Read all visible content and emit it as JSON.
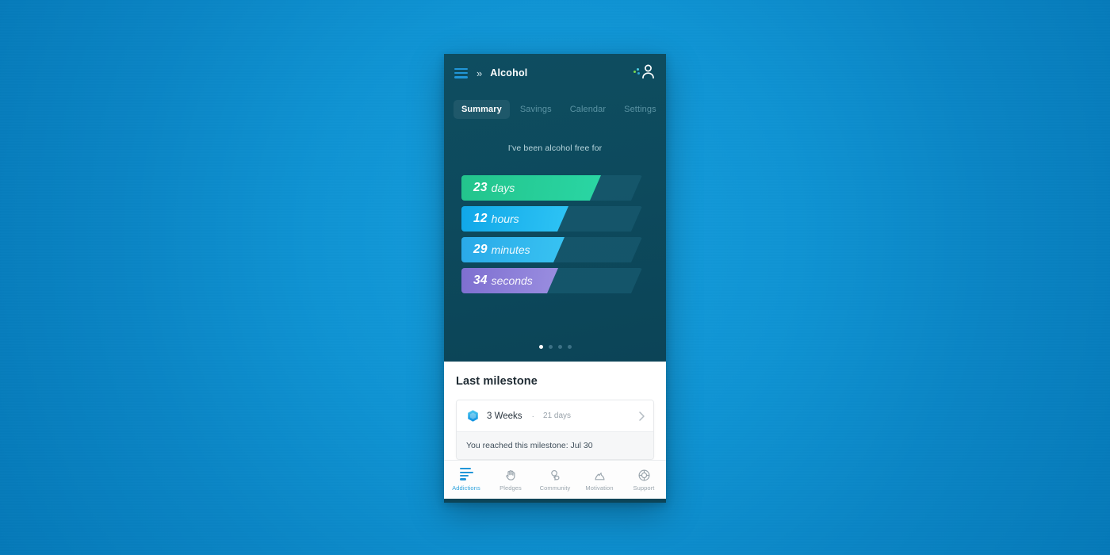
{
  "app": {
    "title": "Alcohol",
    "menu_icon": "hamburger-icon",
    "breadcrumb_chevrons": "»",
    "avatar_icon": "user-avatar-icon"
  },
  "tabs": [
    {
      "label": "Summary",
      "active": true
    },
    {
      "label": "Savings",
      "active": false
    },
    {
      "label": "Calendar",
      "active": false
    },
    {
      "label": "Settings",
      "active": false
    }
  ],
  "summary": {
    "caption": "I've been alcohol free for",
    "counters": [
      {
        "value": "23",
        "unit": "days",
        "fill_width": 176,
        "color_from": "#23c48c",
        "color_to": "#2ad6a4"
      },
      {
        "value": "12",
        "unit": "hours",
        "fill_width": 135,
        "color_from": "#10a7e8",
        "color_to": "#2ec4f5"
      },
      {
        "value": "29",
        "unit": "minutes",
        "fill_width": 130,
        "color_from": "#2aa9e8",
        "color_to": "#38c3f2"
      },
      {
        "value": "34",
        "unit": "seconds",
        "fill_width": 122,
        "color_from": "#7e6fd0",
        "color_to": "#9a8ee0"
      }
    ],
    "carousel": {
      "total": 4,
      "active_index": 0
    }
  },
  "milestone": {
    "section_title": "Last milestone",
    "badge_icon": "hexagon-badge-icon",
    "title": "3 Weeks",
    "separator": "·",
    "subtitle": "21 days",
    "chevron_icon": "chevron-right-icon",
    "footer": "You reached this milestone: Jul 30"
  },
  "bottom_nav": [
    {
      "label": "Addictions",
      "icon": "bar-chart-icon",
      "active": true
    },
    {
      "label": "Pledges",
      "icon": "hand-icon",
      "active": false
    },
    {
      "label": "Community",
      "icon": "chat-bubbles-icon",
      "active": false
    },
    {
      "label": "Motivation",
      "icon": "flame-icon",
      "active": false
    },
    {
      "label": "Support",
      "icon": "life-ring-icon",
      "active": false
    }
  ],
  "colors": {
    "accent_blue": "#2196d8",
    "panel_dark": "#0d4a5d",
    "desktop_blue": "#0f93d3"
  }
}
